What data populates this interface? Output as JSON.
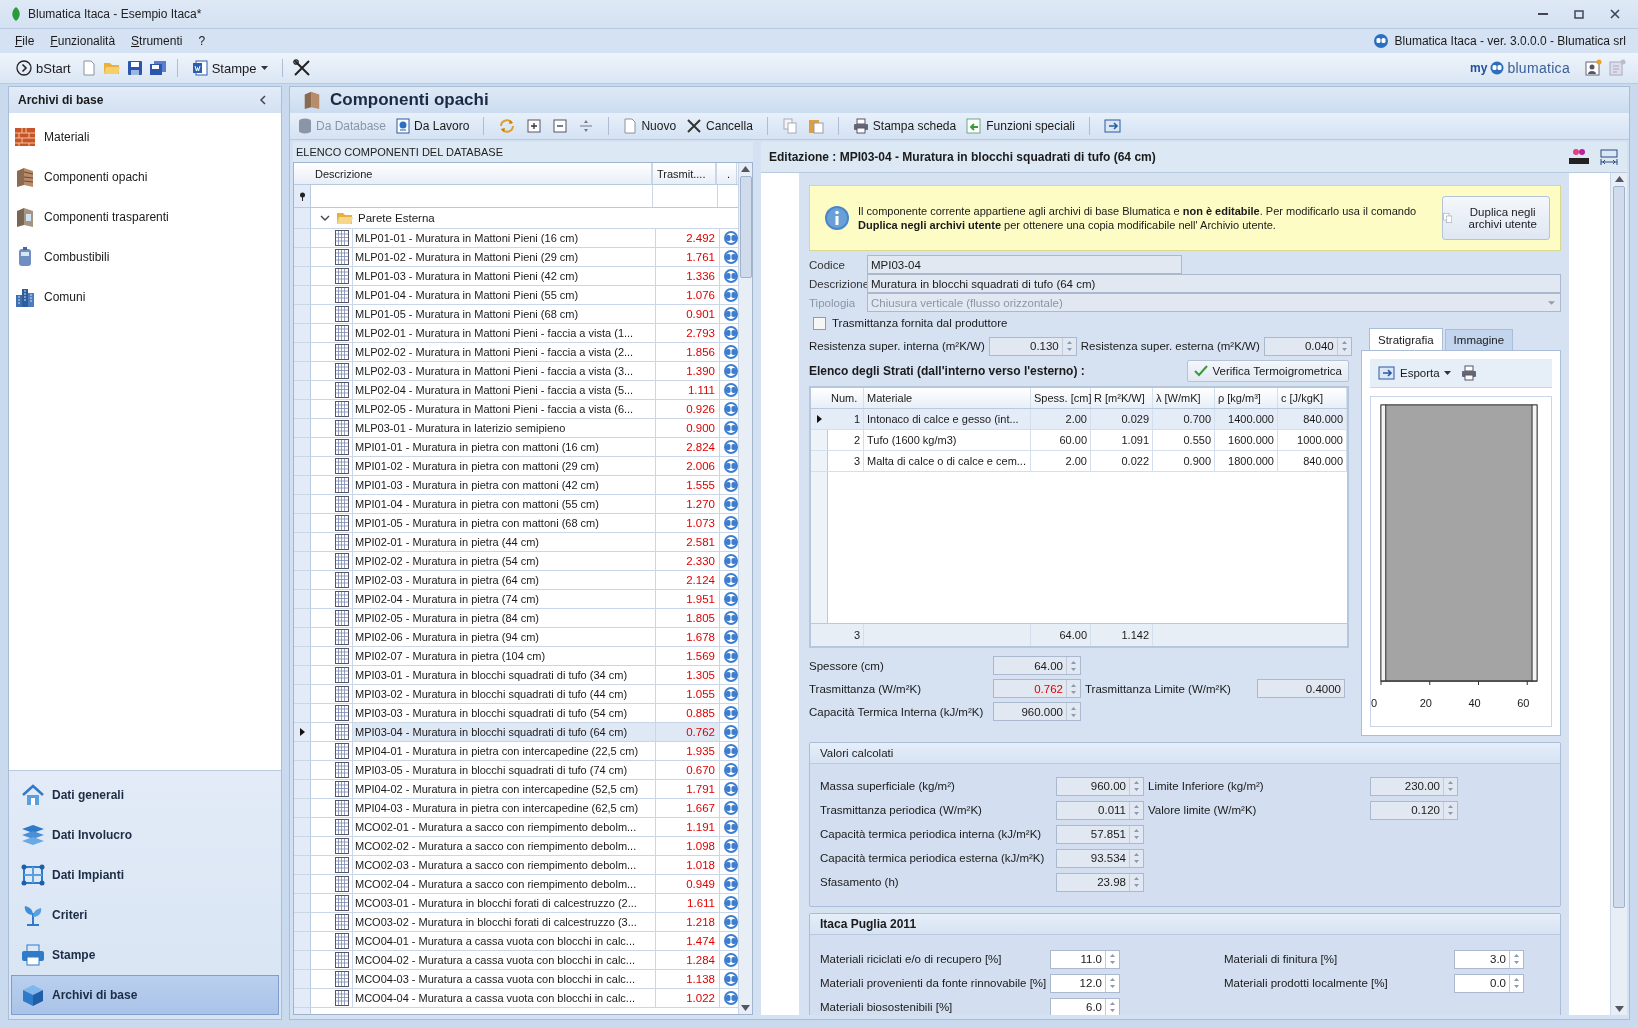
{
  "window": {
    "title": "Blumatica Itaca - Esempio Itaca*"
  },
  "menu": [
    "File",
    "Funzionalità",
    "Strumenti",
    "?"
  ],
  "app_info": "Blumatica Itaca - ver. 3.0.0.0 - Blumatica srl",
  "toolbar": {
    "start": "bStart",
    "print": "Stampe"
  },
  "brand": {
    "prefix": "my",
    "name": "blumatica"
  },
  "sidebar": {
    "title": "Archivi di base",
    "items": [
      {
        "label": "Materiali"
      },
      {
        "label": "Componenti opachi"
      },
      {
        "label": "Componenti trasparenti"
      },
      {
        "label": "Combustibili"
      },
      {
        "label": "Comuni"
      }
    ],
    "nav": [
      {
        "label": "Dati generali",
        "selected": false
      },
      {
        "label": "Dati Involucro",
        "selected": false
      },
      {
        "label": "Dati Impianti",
        "selected": false
      },
      {
        "label": "Criteri",
        "selected": false
      },
      {
        "label": "Stampe",
        "selected": false
      },
      {
        "label": "Archivi di base",
        "selected": true
      }
    ]
  },
  "panel": {
    "title": "Componenti opachi",
    "toolbar": [
      {
        "label": "Da Database",
        "disabled": true
      },
      {
        "label": "Da Lavoro",
        "disabled": false
      },
      {
        "label": "Nuovo",
        "disabled": false
      },
      {
        "label": "Cancella",
        "disabled": false
      },
      {
        "label": "Stampa scheda",
        "disabled": false
      },
      {
        "label": "Funzioni speciali",
        "disabled": false
      }
    ]
  },
  "list": {
    "title": "ELENCO COMPONENTI DEL DATABASE",
    "columns": [
      "Descrizione",
      "Trasmit....",
      "."
    ],
    "group": {
      "label": "Parete Esterna",
      "expanded": true
    },
    "rows": [
      {
        "text": "MLP01-01 - Muratura in Mattoni Pieni (16 cm)",
        "value": "2.492",
        "selected": false
      },
      {
        "text": "MLP01-02 - Muratura in Mattoni Pieni (29 cm)",
        "value": "1.761",
        "selected": false
      },
      {
        "text": "MLP01-03 - Muratura in Mattoni Pieni (42 cm)",
        "value": "1.336",
        "selected": false
      },
      {
        "text": "MLP01-04 - Muratura in Mattoni Pieni (55 cm)",
        "value": "1.076",
        "selected": false
      },
      {
        "text": "MLP01-05 - Muratura in Mattoni Pieni (68 cm)",
        "value": "0.901",
        "selected": false
      },
      {
        "text": "MLP02-01 - Muratura in Mattoni Pieni - faccia a vista (1...",
        "value": "2.793",
        "selected": false
      },
      {
        "text": "MLP02-02 - Muratura in Mattoni Pieni - faccia a vista (2...",
        "value": "1.856",
        "selected": false
      },
      {
        "text": "MLP02-03 - Muratura in Mattoni Pieni - faccia a vista (3...",
        "value": "1.390",
        "selected": false
      },
      {
        "text": "MLP02-04 - Muratura in Mattoni Pieni - faccia a vista (5...",
        "value": "1.111",
        "selected": false
      },
      {
        "text": "MLP02-05 - Muratura in Mattoni Pieni - faccia a vista (6...",
        "value": "0.926",
        "selected": false
      },
      {
        "text": "MLP03-01 - Muratura in laterizio semipieno",
        "value": "0.900",
        "selected": false
      },
      {
        "text": "MPI01-01 - Muratura in pietra con mattoni  (16 cm)",
        "value": "2.824",
        "selected": false
      },
      {
        "text": "MPI01-02 - Muratura in pietra con mattoni (29 cm)",
        "value": "2.006",
        "selected": false
      },
      {
        "text": "MPI01-03 - Muratura in pietra con mattoni (42 cm)",
        "value": "1.555",
        "selected": false
      },
      {
        "text": "MPI01-04 - Muratura in pietra con mattoni (55 cm)",
        "value": "1.270",
        "selected": false
      },
      {
        "text": "MPI01-05 - Muratura in pietra con mattoni (68 cm)",
        "value": "1.073",
        "selected": false
      },
      {
        "text": "MPI02-01 - Muratura in pietra (44 cm)",
        "value": "2.581",
        "selected": false
      },
      {
        "text": "MPI02-02 - Muratura in pietra (54 cm)",
        "value": "2.330",
        "selected": false
      },
      {
        "text": "MPI02-03 - Muratura in pietra (64 cm)",
        "value": "2.124",
        "selected": false
      },
      {
        "text": "MPI02-04 - Muratura in pietra (74 cm)",
        "value": "1.951",
        "selected": false
      },
      {
        "text": "MPI02-05 - Muratura in pietra (84 cm)",
        "value": "1.805",
        "selected": false
      },
      {
        "text": "MPI02-06 - Muratura in pietra (94 cm)",
        "value": "1.678",
        "selected": false
      },
      {
        "text": "MPI02-07 - Muratura in pietra (104 cm)",
        "value": "1.569",
        "selected": false
      },
      {
        "text": "MPI03-01 - Muratura in blocchi squadrati di tufo (34 cm)",
        "value": "1.305",
        "selected": false
      },
      {
        "text": "MPI03-02 - Muratura in blocchi squadrati di tufo (44 cm)",
        "value": "1.055",
        "selected": false
      },
      {
        "text": "MPI03-03 - Muratura in blocchi squadrati di tufo (54 cm)",
        "value": "0.885",
        "selected": false
      },
      {
        "text": "MPI03-04 - Muratura in blocchi squadrati di tufo (64 cm)",
        "value": "0.762",
        "selected": true
      },
      {
        "text": "MPI04-01 - Muratura in pietra con intercapedine (22,5 cm)",
        "value": "1.935",
        "selected": false
      },
      {
        "text": "MPI03-05 - Muratura in blocchi squadrati di tufo (74 cm)",
        "value": "0.670",
        "selected": false
      },
      {
        "text": "MPI04-02 - Muratura in pietra con intercapedine (52,5 cm)",
        "value": "1.791",
        "selected": false
      },
      {
        "text": "MPI04-03 - Muratura in pietra con intercapedine (62,5 cm)",
        "value": "1.667",
        "selected": false
      },
      {
        "text": "MCO02-01 - Muratura a sacco con riempimento debolm...",
        "value": "1.191",
        "selected": false
      },
      {
        "text": "MCO02-02 - Muratura a sacco con riempimento debolm...",
        "value": "1.098",
        "selected": false
      },
      {
        "text": "MCO02-03 - Muratura a sacco con riempimento debolm...",
        "value": "1.018",
        "selected": false
      },
      {
        "text": "MCO02-04 - Muratura a sacco con riempimento debolm...",
        "value": "0.949",
        "selected": false
      },
      {
        "text": "MCO03-01 - Muratura in blocchi forati di calcestruzzo (2...",
        "value": "1.611",
        "selected": false
      },
      {
        "text": "MCO03-02 - Muratura in blocchi forati di calcestruzzo (3...",
        "value": "1.218",
        "selected": false
      },
      {
        "text": "MCO04-01 - Muratura a cassa vuota con blocchi in calc...",
        "value": "1.474",
        "selected": false
      },
      {
        "text": "MCO04-02 - Muratura a cassa vuota con blocchi in calc...",
        "value": "1.284",
        "selected": false
      },
      {
        "text": "MCO04-03 - Muratura a cassa vuota con blocchi in calc...",
        "value": "1.138",
        "selected": false
      },
      {
        "text": "MCO04-04 - Muratura a cassa vuota con blocchi in calc...",
        "value": "1.022",
        "selected": false
      }
    ]
  },
  "editor": {
    "title": "Editazione : MPI03-04 - Muratura in blocchi squadrati di tufo (64 cm)",
    "notice": "Il componente corrente appartiene agli archivi di base Blumatica e **non è editabile**. Per modificarlo usa il comando **Duplica negli archivi utente** per ottenere una copia modificabile nell' Archivio utente.",
    "notice_button": "Duplica negli archivi utente",
    "code": {
      "label": "Codice",
      "value": "MPI03-04"
    },
    "description": {
      "label": "Descrizione",
      "value": "Muratura in blocchi squadrati di tufo (64 cm)"
    },
    "type": {
      "label": "Tipologia",
      "value": "Chiusura verticale (flusso orizzontale)",
      "disabled": true
    },
    "producer_check": {
      "label": "Trasmittanza fornita dal produttore",
      "checked": false
    },
    "resistances": [
      {
        "label": "Resistenza super. interna (m²K/W)",
        "value": "0.130"
      },
      {
        "label": "Resistenza super. esterna (m²K/W)",
        "value": "0.040"
      }
    ],
    "strata": {
      "title": "Elenco degli Strati  (dall'interno verso l'esterno) :",
      "verify": "Verifica Termoigrometrica",
      "columns": [
        "Num.",
        "Materiale",
        "Spess. [cm]",
        "R [m²K/W]",
        "λ [W/mK]",
        "ρ [kg/m³]",
        "c [J/kgK]"
      ],
      "rows": [
        {
          "cells": [
            "1",
            "Intonaco di calce e gesso (int...",
            "2.00",
            "0.029",
            "0.700",
            "1400.000",
            "840.000"
          ],
          "selected": true
        },
        {
          "cells": [
            "2",
            "Tufo (1600 kg/m3)",
            "60.00",
            "1.091",
            "0.550",
            "1600.000",
            "1000.000"
          ],
          "selected": false
        },
        {
          "cells": [
            "3",
            "Malta di calce o di calce e cem...",
            "2.00",
            "0.022",
            "0.900",
            "1800.000",
            "840.000"
          ],
          "selected": false
        }
      ],
      "footer": {
        "count": "3",
        "thickness": "64.00",
        "resistance": "1.142"
      }
    },
    "summary": [
      {
        "label": "Spessore (cm)",
        "value": "64.00",
        "alert": false
      },
      {
        "label": "Trasmittanza (W/m²K)",
        "value": "0.762",
        "alert": true,
        "limit_label": "Trasmittanza Limite (W/m²K)",
        "limit_value": "0.4000"
      },
      {
        "label": "Capacità Termica Interna (kJ/m²K)",
        "value": "960.000",
        "alert": false
      }
    ],
    "tabs": [
      {
        "label": "Stratigrafia",
        "selected": true
      },
      {
        "label": "Immagine",
        "selected": false
      }
    ],
    "export": "Esporta",
    "axis_ticks": [
      "0",
      "20",
      "40",
      "60"
    ],
    "calculated": {
      "title": "Valori calcolati",
      "left": [
        {
          "label": "Massa superficiale (kg/m²)",
          "value": "960.00"
        },
        {
          "label": "Trasmittanza periodica (W/m²K)",
          "value": "0.011"
        },
        {
          "label": "Capacità termica periodica interna (kJ/m²K)",
          "value": "57.851"
        },
        {
          "label": "Capacità termica periodica esterna (kJ/m²K)",
          "value": "93.534"
        },
        {
          "label": "Sfasamento (h)",
          "value": "23.98"
        }
      ],
      "right": [
        {
          "label": "Limite Inferiore (kg/m²)",
          "value": "230.00"
        },
        {
          "label": "Valore limite (W/m²K)",
          "value": "0.120"
        }
      ]
    },
    "itaca": {
      "title": "Itaca Puglia 2011",
      "left": [
        {
          "label": "Materiali riciclati e/o di recupero [%]",
          "value": "11.0"
        },
        {
          "label": "Materiali provenienti da fonte rinnovabile [%]",
          "value": "12.0"
        },
        {
          "label": "Materiali biosostenibili [%]",
          "value": "6.0"
        }
      ],
      "right": [
        {
          "label": "Materiali di finitura [%]",
          "value": "3.0"
        },
        {
          "label": "Materiali prodotti localmente [%]",
          "value": "0.0"
        }
      ]
    }
  }
}
